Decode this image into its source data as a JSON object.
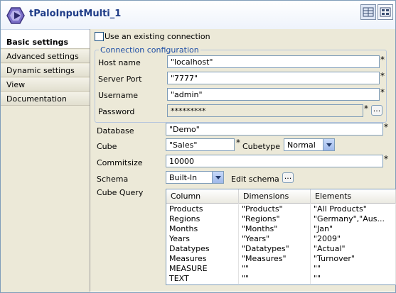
{
  "header": {
    "title": "tPaloInputMulti_1",
    "view_icons": [
      "table-view-icon",
      "form-view-icon"
    ]
  },
  "tabs": [
    {
      "label": "Basic settings",
      "active": true
    },
    {
      "label": "Advanced settings",
      "active": false
    },
    {
      "label": "Dynamic settings",
      "active": false
    },
    {
      "label": "View",
      "active": false
    },
    {
      "label": "Documentation",
      "active": false
    }
  ],
  "form": {
    "use_existing_connection": {
      "label": "Use an existing connection",
      "checked": false
    },
    "connection_group_label": "Connection configuration",
    "host_label": "Host name",
    "host_value": "\"localhost\"",
    "port_label": "Server Port",
    "port_value": "\"7777\"",
    "username_label": "Username",
    "username_value": "\"admin\"",
    "password_label": "Password",
    "password_value": "*********",
    "database_label": "Database",
    "database_value": "\"Demo\"",
    "cube_label": "Cube",
    "cube_value": "\"Sales\"",
    "cubetype_label": "Cubetype",
    "cubetype_value": "Normal",
    "commitsize_label": "Commitsize",
    "commitsize_value": "10000",
    "schema_label": "Schema",
    "schema_value": "Built-In",
    "edit_schema_label": "Edit schema",
    "cube_query_label": "Cube Query",
    "required_mark": "*",
    "ellipsis": "..."
  },
  "cube_query": {
    "columns": [
      "Column",
      "Dimensions",
      "Elements"
    ],
    "rows": [
      [
        "Products",
        "\"Products\"",
        "\"All Products\""
      ],
      [
        "Regions",
        "\"Regions\"",
        "\"Germany\",\"Aus..."
      ],
      [
        "Months",
        "\"Months\"",
        "\"Jan\""
      ],
      [
        "Years",
        "\"Years\"",
        "\"2009\""
      ],
      [
        "Datatypes",
        "\"Datatypes\"",
        "\"Actual\""
      ],
      [
        "Measures",
        "\"Measures\"",
        "\"Turnover\""
      ],
      [
        "MEASURE",
        "\"\"",
        "\"\""
      ],
      [
        "TEXT",
        "\"\"",
        "\"\""
      ]
    ]
  }
}
